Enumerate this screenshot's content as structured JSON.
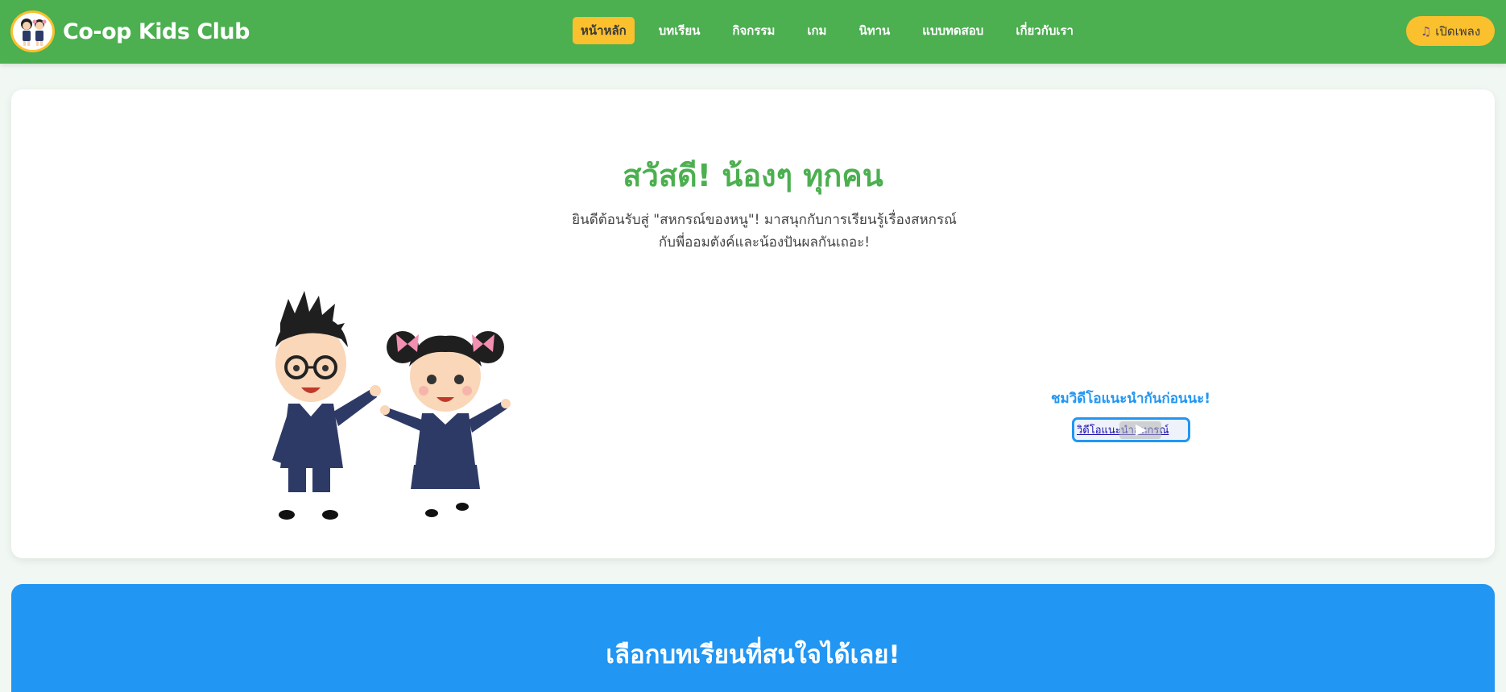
{
  "brand": {
    "name": "Co-op Kids Club",
    "logo_icon": "kids-logo-icon"
  },
  "nav": {
    "items": [
      {
        "label": "หน้าหลัก",
        "active": true
      },
      {
        "label": "บทเรียน",
        "active": false
      },
      {
        "label": "กิจกรรม",
        "active": false
      },
      {
        "label": "เกม",
        "active": false
      },
      {
        "label": "นิทาน",
        "active": false
      },
      {
        "label": "แบบทดสอบ",
        "active": false
      },
      {
        "label": "เกี่ยวกับเรา",
        "active": false
      }
    ]
  },
  "music_button": {
    "icon": "music-note-icon",
    "label": "เปิดเพลง"
  },
  "hero": {
    "title": "สวัสดี! น้องๆ ทุกคน",
    "description_line1": "ยินดีต้อนรับสู่ \"สหกรณ์ของหนู\"! มาสนุกกับการเรียนรู้เรื่องสหกรณ์",
    "description_line2": "กับพี่ออมตังค์และน้องปันผลกันเถอะ!",
    "illustration": "two-students-cartoon",
    "video_label": "ชมวิดีโอแนะนำกันก่อนนะ!",
    "video_alt": "วิดีโอแนะนำสหกรณ์"
  },
  "lessons": {
    "title": "เลือกบทเรียนที่สนใจได้เลย!"
  },
  "colors": {
    "header_green": "#4caf50",
    "accent_yellow": "#fbc02d",
    "section_blue": "#2196f3",
    "page_bg": "#f1f7f2"
  }
}
